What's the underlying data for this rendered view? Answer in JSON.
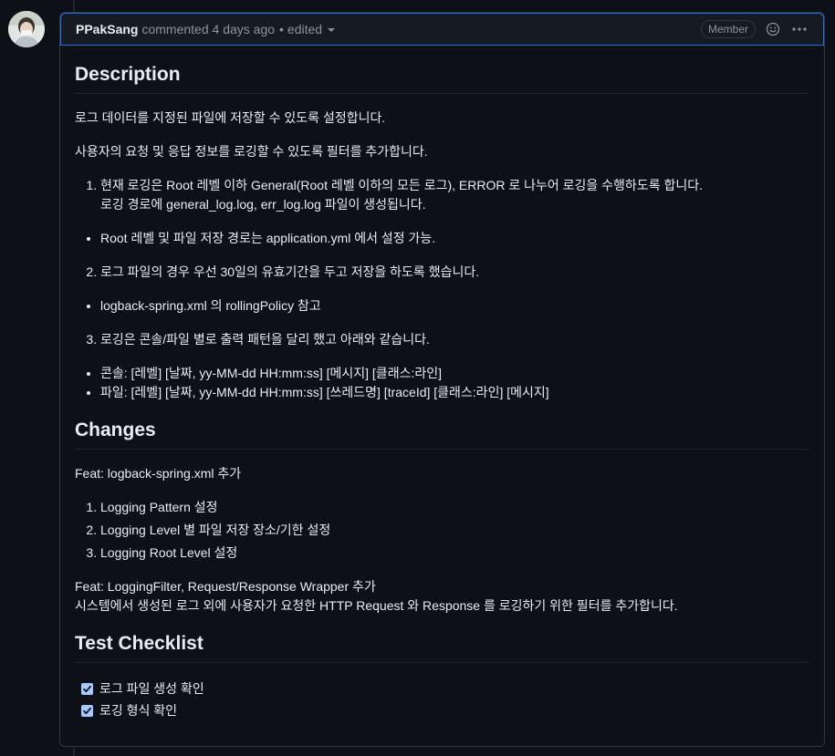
{
  "header": {
    "author": "PPakSang",
    "meta": "commented 4 days ago",
    "separator": "•",
    "edited": "edited",
    "badge": "Member"
  },
  "sections": {
    "description": {
      "title": "Description",
      "p1": "로그 데이터를 지정된 파일에 저장할 수 있도록 설정합니다.",
      "p2": "사용자의 요청 및 응답 정보를 로깅할 수 있도록 필터를 추가합니다.",
      "item1_line1": "현재 로깅은 Root 레벨 이하 General(Root 레벨 이하의 모든 로그), ERROR 로 나누어 로깅을 수행하도록 합니다.",
      "item1_line2": "로깅 경로에 general_log.log, err_log.log 파일이 생성됩니다.",
      "bullet1": "Root 레벨 및 파일 저장 경로는 application.yml 에서 설정 가능.",
      "item2": "로그 파일의 경우 우선 30일의 유효기간을 두고 저장을 하도록 했습니다.",
      "bullet2": "logback-spring.xml 의 rollingPolicy 참고",
      "item3": "로깅은 콘솔/파일 별로 출력 패턴을 달리 했고 아래와 같습니다.",
      "bullet3": "콘솔: [레벨] [날짜, yy-MM-dd HH:mm:ss] [메시지] [클래스:라인]",
      "bullet4": "파일: [레벨] [날짜, yy-MM-dd HH:mm:ss] [쓰레드명] [traceId] [클래스:라인] [메시지]"
    },
    "changes": {
      "title": "Changes",
      "feat1": "Feat: logback-spring.xml 추가",
      "items": [
        "Logging Pattern 설정",
        "Logging Level 별 파일 저장 장소/기한 설정",
        "Logging Root Level 설정"
      ],
      "feat2_line1": "Feat: LoggingFilter, Request/Response Wrapper 추가",
      "feat2_line2": "시스템에서 생성된 로그 외에 사용자가 요청한 HTTP Request 와 Response 를 로깅하기 위한 필터를 추가합니다."
    },
    "checklist": {
      "title": "Test Checklist",
      "items": [
        "로그 파일 생성 확인",
        "로깅 형식 확인"
      ]
    }
  }
}
